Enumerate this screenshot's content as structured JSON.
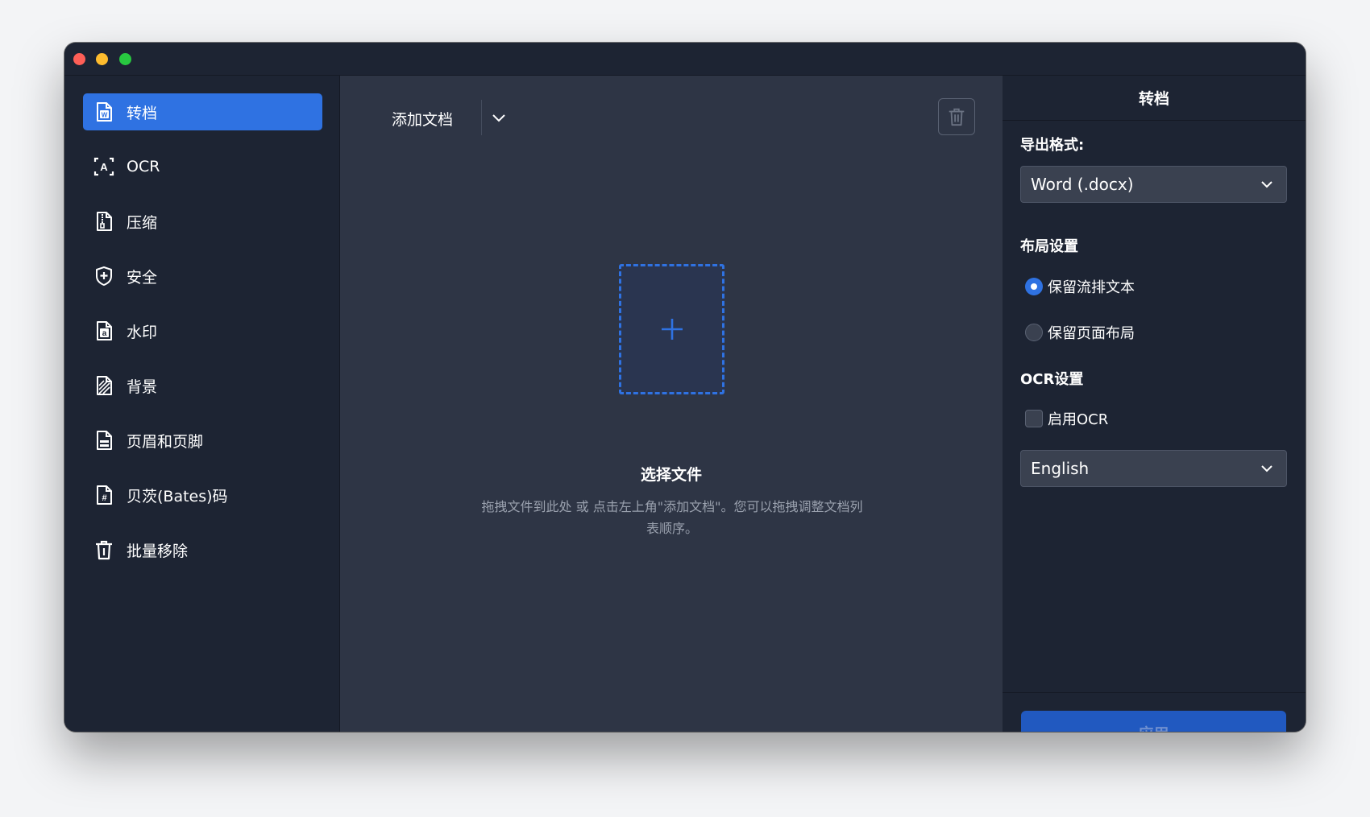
{
  "sidebar": {
    "items": [
      {
        "label": "转档",
        "icon": "word-doc-icon"
      },
      {
        "label": "OCR",
        "icon": "ocr-scan-icon"
      },
      {
        "label": "压缩",
        "icon": "zip-file-icon"
      },
      {
        "label": "安全",
        "icon": "shield-plus-icon"
      },
      {
        "label": "水印",
        "icon": "watermark-file-icon"
      },
      {
        "label": "背景",
        "icon": "background-file-icon"
      },
      {
        "label": "页眉和页脚",
        "icon": "header-footer-file-icon"
      },
      {
        "label": "贝茨(Bates)码",
        "icon": "bates-number-file-icon"
      },
      {
        "label": "批量移除",
        "icon": "trash-icon"
      }
    ],
    "active_index": 0
  },
  "main": {
    "add_document": "添加文档",
    "drop_title": "选择文件",
    "drop_hint": "拖拽文件到此处 或 点击左上角\"添加文档\"。您可以拖拽调整文档列表顺序。"
  },
  "panel": {
    "title": "转档",
    "export_format_label": "导出格式:",
    "export_format_value": "Word (.docx)",
    "layout_label": "布局设置",
    "layout_options": [
      {
        "label": "保留流排文本",
        "selected": true
      },
      {
        "label": "保留页面布局",
        "selected": false
      }
    ],
    "ocr_label": "OCR设置",
    "ocr_enable": {
      "label": "启用OCR",
      "checked": false
    },
    "ocr_language": "English",
    "apply": "应用"
  },
  "colors": {
    "accent": "#2f72e2",
    "sidebar_bg": "#1d2433",
    "main_bg": "#2e3545"
  }
}
